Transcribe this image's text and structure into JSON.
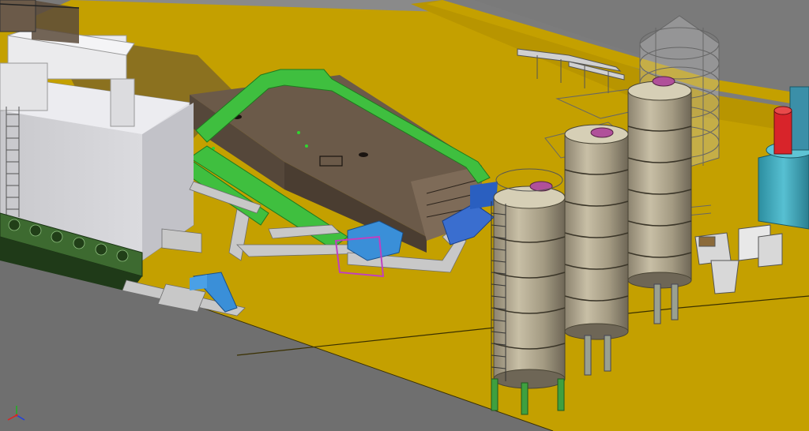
{
  "viewport": {
    "background": "#7a7a7a",
    "floor_color": "#c9a400",
    "silo_body_color": "#a89f86",
    "building_color": "#d8d8dc",
    "oven_color": "#6b5a49",
    "duct_color": "#3fbf3f",
    "conveyor_color": "#c8c8c8",
    "accent_blue": "#3a8fd8",
    "accent_magenta": "#c040c0",
    "tank_teal": "#3aa5b8",
    "tank_red": "#d8242a"
  },
  "triad": {
    "axis_x_color": "#e02020",
    "axis_y_color": "#20b020",
    "axis_z_color": "#2040e0"
  }
}
